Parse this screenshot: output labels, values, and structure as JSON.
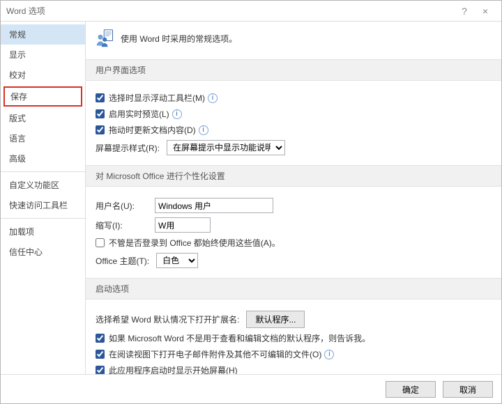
{
  "titlebar": {
    "title": "Word 选项",
    "help": "?",
    "close": "×"
  },
  "nav": {
    "items": [
      "常规",
      "显示",
      "校对",
      "保存",
      "版式",
      "语言",
      "高级"
    ],
    "items2": [
      "自定义功能区",
      "快速访问工具栏"
    ],
    "items3": [
      "加载项",
      "信任中心"
    ],
    "selected": 0,
    "highlight": 3
  },
  "header": {
    "text": "使用 Word 时采用的常规选项。"
  },
  "ui_section": {
    "title": "用户界面选项",
    "cb1": "选择时显示浮动工具栏(M)",
    "cb2": "启用实时预览(L)",
    "cb3": "拖动时更新文档内容(D)",
    "tip_label": "屏幕提示样式(R):",
    "tip_value": "在屏幕提示中显示功能说明"
  },
  "personal_section": {
    "title": "对 Microsoft Office 进行个性化设置",
    "user_label": "用户名(U):",
    "user_value": "Windows 用户",
    "init_label": "缩写(I):",
    "init_value": "W用",
    "always_cb": "不管是否登录到 Office 都始终使用这些值(A)。",
    "theme_label": "Office 主题(T):",
    "theme_value": "白色"
  },
  "startup_section": {
    "title": "启动选项",
    "ext_label": "选择希望 Word 默认情况下打开扩展名:",
    "ext_btn": "默认程序...",
    "cb1": "如果 Microsoft Word 不是用于查看和编辑文档的默认程序，则告诉我。",
    "cb2": "在阅读视图下打开电子邮件附件及其他不可编辑的文件(O)",
    "cb3": "此应用程序启动时显示开始屏幕(H)"
  },
  "footer": {
    "ok": "确定",
    "cancel": "取消"
  }
}
